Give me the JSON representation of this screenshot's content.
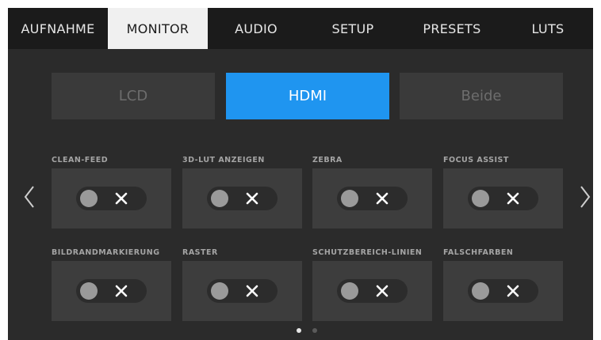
{
  "tabs": [
    {
      "label": "AUFNAHME",
      "active": false
    },
    {
      "label": "MONITOR",
      "active": true
    },
    {
      "label": "AUDIO",
      "active": false
    },
    {
      "label": "SETUP",
      "active": false
    },
    {
      "label": "PRESETS",
      "active": false
    },
    {
      "label": "LUTS",
      "active": false
    }
  ],
  "output_selector": {
    "options": [
      "LCD",
      "HDMI",
      "Beide"
    ],
    "selected": "HDMI"
  },
  "toggles": {
    "clean_feed": {
      "label": "CLEAN-FEED",
      "state": "off"
    },
    "lut_3d": {
      "label": "3D-LUT ANZEIGEN",
      "state": "off"
    },
    "zebra": {
      "label": "ZEBRA",
      "state": "off"
    },
    "focus_assist": {
      "label": "FOCUS ASSIST",
      "state": "off"
    },
    "frame_guides": {
      "label": "BILDRANDMARKIERUNG",
      "state": "off"
    },
    "grid": {
      "label": "RASTER",
      "state": "off"
    },
    "safe_area": {
      "label": "SCHUTZBEREICH-LINIEN",
      "state": "off"
    },
    "false_color": {
      "label": "FALSCHFARBEN",
      "state": "off"
    }
  },
  "pagination": {
    "current_page": 1,
    "total_pages": 2
  },
  "colors": {
    "accent": "#1f95f0",
    "background": "#2b2b2b",
    "tabbar": "#1b1b1b",
    "card": "#3d3d3d"
  },
  "icons": {
    "prev": "chevron-left-icon",
    "next": "chevron-right-icon",
    "toggle_off": "x-icon"
  }
}
